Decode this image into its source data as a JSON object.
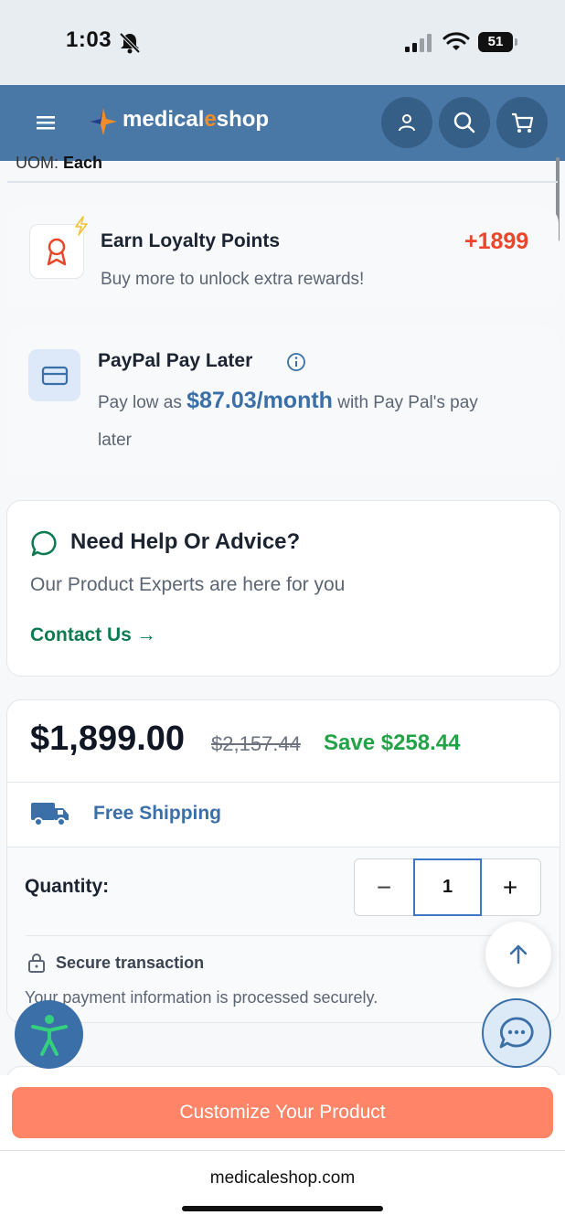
{
  "status_bar": {
    "time": "1:03",
    "battery": "51"
  },
  "header": {
    "brand_main": "medical",
    "brand_accent": "e",
    "brand_end": "shop",
    "icons": [
      "menu-icon",
      "user-icon",
      "search-icon",
      "cart-icon"
    ]
  },
  "product": {
    "uom_label": "UOM:",
    "uom_value": "Each"
  },
  "loyalty": {
    "title": "Earn Loyalty Points",
    "points": "+1899",
    "subtitle": "Buy more to unlock extra rewards!"
  },
  "paypal": {
    "title": "PayPal Pay Later",
    "prefix": "Pay low as",
    "amount": "$87.03/month",
    "suffix_line1": "with Pay Pal's pay",
    "suffix_line2": "later"
  },
  "help": {
    "title": "Need Help Or Advice?",
    "subtitle": "Our Product Experts are here for you",
    "link": "Contact Us →"
  },
  "pricing": {
    "price": "$1,899.00",
    "original": "$2,157.44",
    "save": "Save $258.44",
    "shipping": "Free Shipping",
    "quantity_label": "Quantity:",
    "quantity_value": "1",
    "minus": "−",
    "plus": "+",
    "secure_title": "Secure transaction",
    "secure_text": "Your payment information is processed securely."
  },
  "cta": {
    "label": "Customize Your Product"
  },
  "browser": {
    "domain": "medicaleshop.com"
  },
  "colors": {
    "header_bg": "#4a78a6",
    "accent_red": "#e8472b",
    "accent_green": "#22a347",
    "link_green": "#0e7a52",
    "paypal_blue": "#3a6fa8",
    "cta_bg": "#ff8468"
  }
}
